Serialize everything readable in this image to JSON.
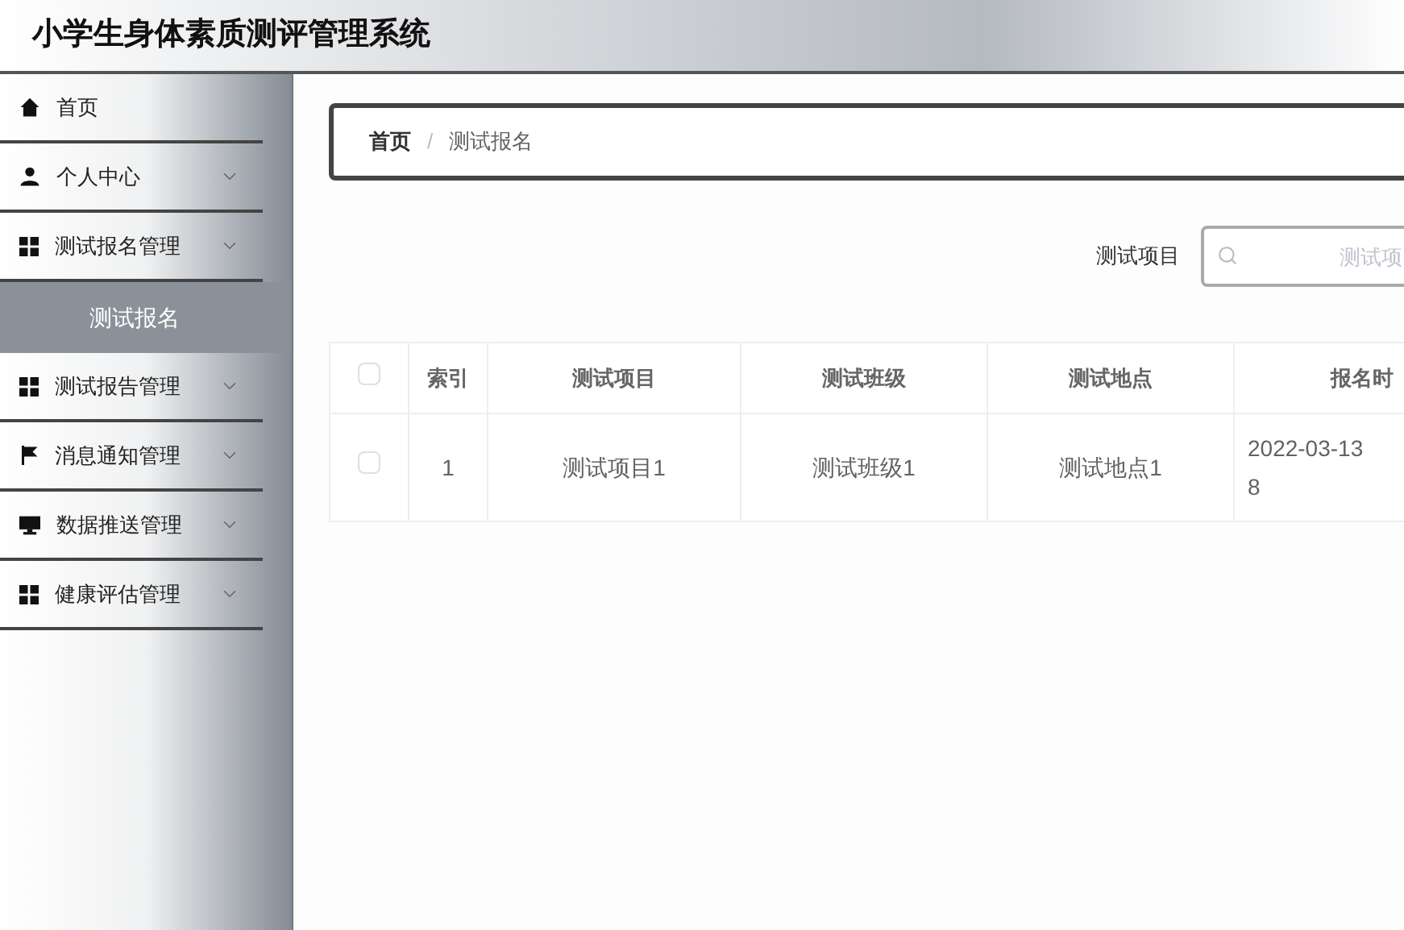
{
  "header": {
    "title": "小学生身体素质测评管理系统"
  },
  "sidebar": {
    "items": [
      {
        "label": "首页",
        "kind": "link"
      },
      {
        "label": "个人中心",
        "kind": "submenu"
      },
      {
        "label": "测试报名管理",
        "kind": "submenu",
        "children": [
          {
            "label": "测试报名",
            "selected": true
          }
        ]
      },
      {
        "label": "测试报告管理",
        "kind": "submenu"
      },
      {
        "label": "消息通知管理",
        "kind": "submenu"
      },
      {
        "label": "数据推送管理",
        "kind": "submenu"
      },
      {
        "label": "健康评估管理",
        "kind": "submenu"
      }
    ]
  },
  "breadcrumb": {
    "items": [
      "首页",
      "测试报名"
    ],
    "separator": "/"
  },
  "search": {
    "label": "测试项目",
    "placeholder": "测试项"
  },
  "table": {
    "columns": [
      "索引",
      "测试项目",
      "测试班级",
      "测试地点",
      "报名时"
    ],
    "rows": [
      {
        "checked": false,
        "cells": [
          "1",
          "测试项目1",
          "测试班级1",
          "测试地点1",
          [
            "2022-03-13",
            "8"
          ]
        ]
      }
    ],
    "all_checked": false
  }
}
